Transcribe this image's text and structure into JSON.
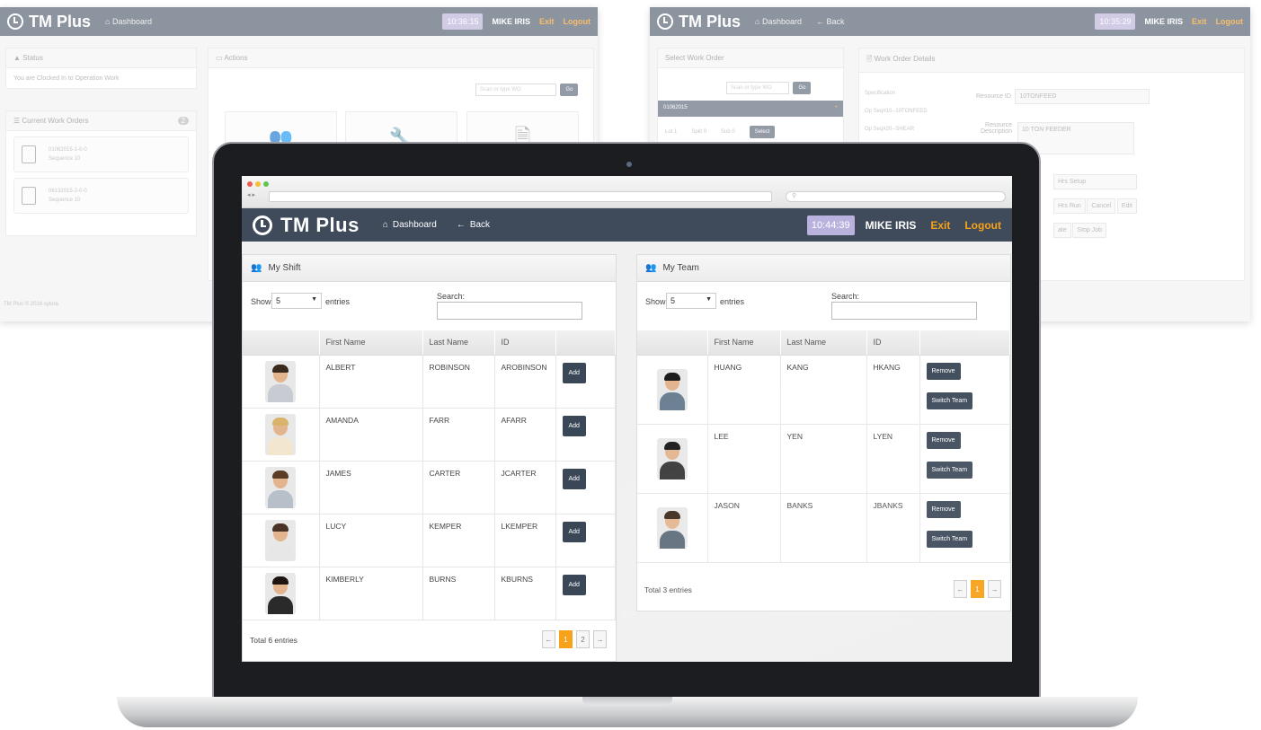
{
  "app": {
    "name": "TM Plus",
    "nav_dashboard": "Dashboard",
    "nav_back": "Back",
    "time": "10:44:39",
    "user": "MIKE IRIS",
    "exit": "Exit",
    "logout": "Logout"
  },
  "bg_left": {
    "name": "TM Plus",
    "nav_dashboard": "Dashboard",
    "time": "10:36:15",
    "user": "MIKE IRIS",
    "exit": "Exit",
    "logout": "Logout",
    "status_title": "Status",
    "status_text": "You are Clocked In to Operation Work",
    "work_orders_title": "Current Work Orders",
    "work_orders_count": "2",
    "work_orders": [
      {
        "line1": "01062015-1-0-0",
        "line2": "Sequence 10"
      },
      {
        "line1": "06132015-2-0-0",
        "line2": "Sequence 10"
      }
    ],
    "actions_title": "Actions",
    "scan_placeholder": "Scan or type WO",
    "go": "Go",
    "footer": "TM Plus © 2016 sylora"
  },
  "bg_right": {
    "name": "TM Plus",
    "nav_dashboard": "Dashboard",
    "nav_back": "Back",
    "time": "10:35:29",
    "user": "MIKE IRIS",
    "exit": "Exit",
    "logout": "Logout",
    "select_title": "Select Work Order",
    "scan_placeholder": "Scan or type WO",
    "go": "Go",
    "wo_number": "01062015",
    "lot": "Lot 1",
    "split": "Split 0",
    "sub": "Sub 0",
    "select": "Select",
    "details_title": "Work Order Details",
    "specification": "Specification",
    "op1": "Op Seq#10--10TONFEED",
    "op2": "Op Seq#20--SHEAR",
    "resource_id_label": "Resource ID",
    "resource_id": "10TONFEED",
    "resource_desc_label": "Resource Description",
    "resource_desc": "10 TON FEEDER",
    "hrs_setup": "Hrs Setup",
    "hrs_run": "Hrs Run",
    "cancel": "Cancel",
    "edit": "Edit",
    "date": "ate",
    "stop_job": "Stop Job"
  },
  "my_shift": {
    "title": "My Shift",
    "show": "Show",
    "page_size": "5",
    "entries": "entries",
    "search": "Search:",
    "headers": [
      "",
      "First Name",
      "Last Name",
      "ID",
      ""
    ],
    "rows": [
      {
        "first": "ALBERT",
        "last": "ROBINSON",
        "id": "AROBINSON",
        "action": "Add"
      },
      {
        "first": "AMANDA",
        "last": "FARR",
        "id": "AFARR",
        "action": "Add"
      },
      {
        "first": "JAMES",
        "last": "CARTER",
        "id": "JCARTER",
        "action": "Add"
      },
      {
        "first": "LUCY",
        "last": "KEMPER",
        "id": "LKEMPER",
        "action": "Add"
      },
      {
        "first": "KIMBERLY",
        "last": "BURNS",
        "id": "KBURNS",
        "action": "Add"
      }
    ],
    "total": "Total 6 entries",
    "pages": [
      "←",
      "1",
      "2",
      "→"
    ]
  },
  "my_team": {
    "title": "My Team",
    "show": "Show",
    "page_size": "5",
    "entries": "entries",
    "search": "Search:",
    "headers": [
      "",
      "First Name",
      "Last Name",
      "ID",
      ""
    ],
    "rows": [
      {
        "first": "HUANG",
        "last": "KANG",
        "id": "HKANG",
        "remove": "Remove",
        "switch": "Switch Team"
      },
      {
        "first": "LEE",
        "last": "YEN",
        "id": "LYEN",
        "remove": "Remove",
        "switch": "Switch Team"
      },
      {
        "first": "JASON",
        "last": "BANKS",
        "id": "JBANKS",
        "remove": "Remove",
        "switch": "Switch Team"
      }
    ],
    "total": "Total 3 entries",
    "pages": [
      "←",
      "1",
      "→"
    ]
  },
  "colors": {
    "nav_bg": "#3f4a5a",
    "accent": "#f7a21b",
    "time_badge": "#b9b2df",
    "button_dark": "#3a4757"
  }
}
